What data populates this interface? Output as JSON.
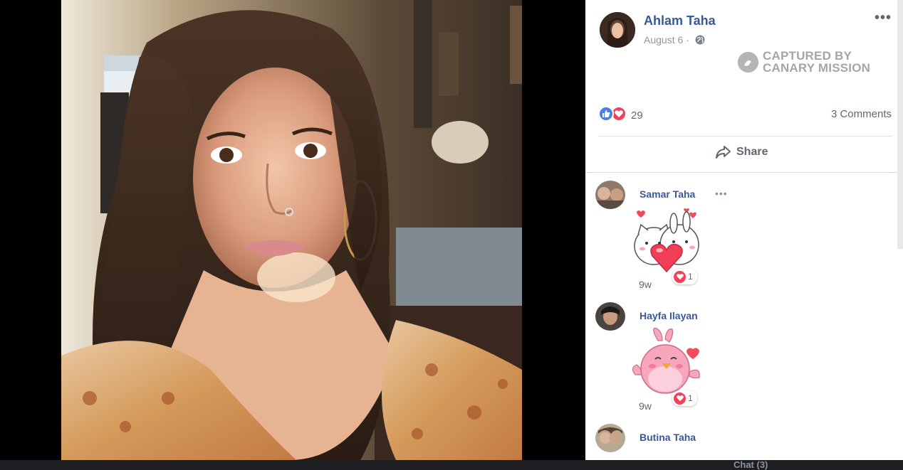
{
  "post": {
    "author": "Ahlam Taha",
    "date": "August 6",
    "separator": "·",
    "privacy_icon": "globe-icon",
    "more_icon": "•••"
  },
  "watermark": {
    "line1": "CAPTURED BY",
    "line2": "CANARY MISSION"
  },
  "reactions": {
    "types": [
      "like",
      "love"
    ],
    "count": "29",
    "comments_count": "3 Comments"
  },
  "actions": {
    "share_label": "Share"
  },
  "comments": [
    {
      "name": "Samar Taha",
      "more": "•••",
      "sticker": "cat-bunny-heart-sticker",
      "time": "9w",
      "reaction_count": "1"
    },
    {
      "name": "Hayfa Ilayan",
      "sticker": "pink-bird-heart-sticker",
      "time": "9w",
      "reaction_count": "1"
    },
    {
      "name": "Butina Taha"
    }
  ],
  "footer": {
    "chat_label": "Chat (3)"
  },
  "colors": {
    "link_blue": "#385898",
    "like_blue": "#4a7fe6",
    "love_red": "#f0405a",
    "muted_gray": "#606770"
  }
}
